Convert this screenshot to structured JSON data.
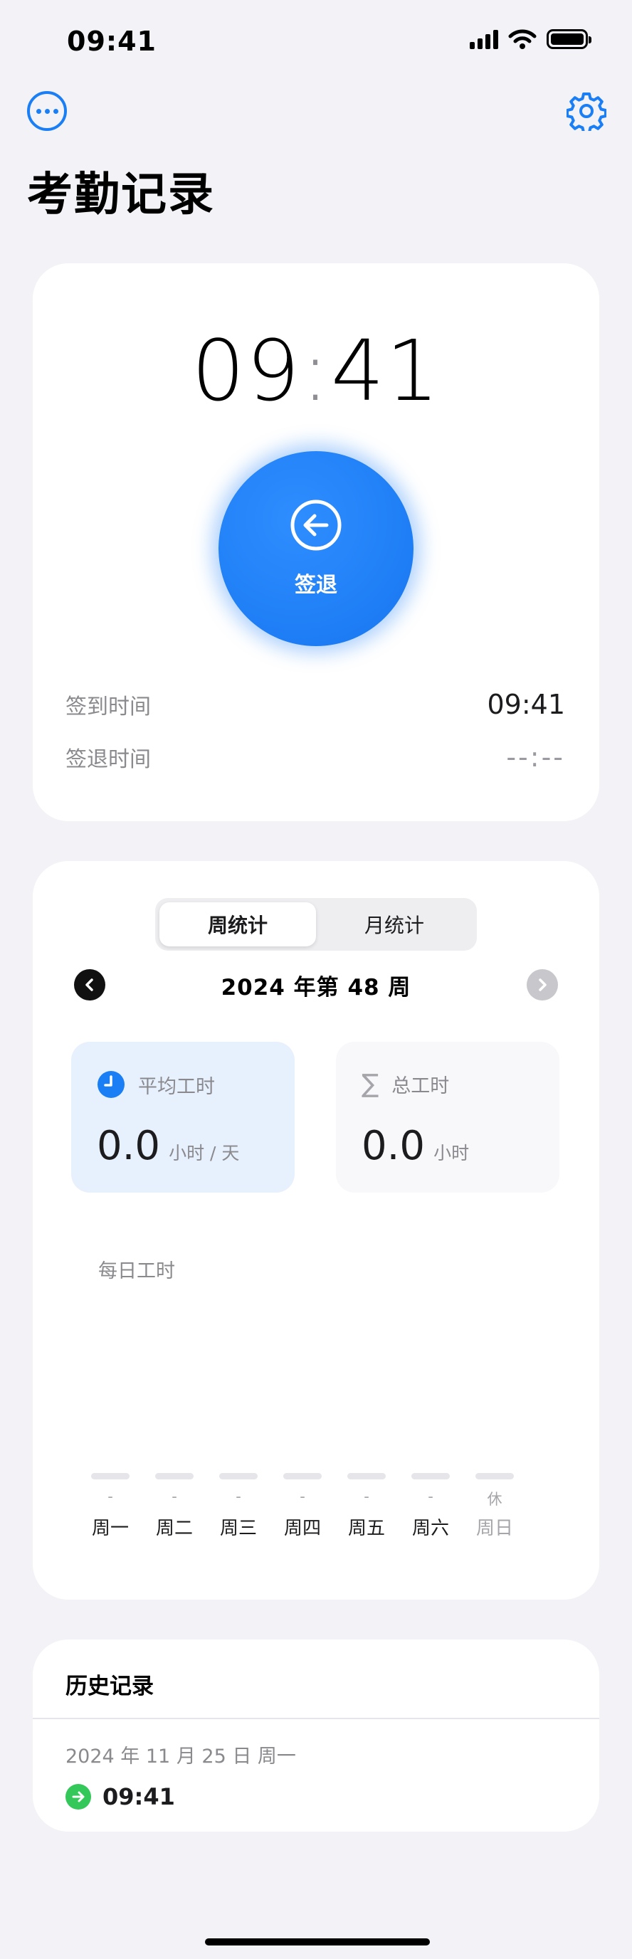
{
  "status_bar": {
    "time": "09:41"
  },
  "nav": {
    "more_icon": "ellipsis-circle-icon",
    "settings_icon": "gear-icon"
  },
  "page": {
    "title": "考勤记录"
  },
  "clock": {
    "hours": "09",
    "separator": ":",
    "minutes": "41",
    "action_label": "签退",
    "action_icon": "arrow-left-circle-icon",
    "check_in_label": "签到时间",
    "check_in_value": "09:41",
    "check_out_label": "签退时间",
    "check_out_value": "--:--"
  },
  "stats": {
    "tabs": [
      {
        "label": "周统计",
        "active": true
      },
      {
        "label": "月统计",
        "active": false
      }
    ],
    "week_label": "2024 年第 48 周",
    "avg": {
      "label": "平均工时",
      "value": "0.0",
      "unit": "小时 / 天",
      "icon": "clock-icon"
    },
    "total": {
      "label": "总工时",
      "value": "0.0",
      "unit": "小时",
      "icon": "sigma-icon"
    },
    "daily_label": "每日工时",
    "days": [
      {
        "name": "周一",
        "value": "-"
      },
      {
        "name": "周二",
        "value": "-"
      },
      {
        "name": "周三",
        "value": "-"
      },
      {
        "name": "周四",
        "value": "-"
      },
      {
        "name": "周五",
        "value": "-"
      },
      {
        "name": "周六",
        "value": "-"
      },
      {
        "name": "周日",
        "value": "休"
      }
    ]
  },
  "history": {
    "title": "历史记录",
    "entries": [
      {
        "date": "2024 年 11 月 25 日 周一",
        "time": "09:41",
        "icon": "arrow-right-circle-icon"
      }
    ]
  },
  "colors": {
    "accent": "#1A7EF5",
    "success": "#34C759",
    "background": "#F2F2F7"
  }
}
